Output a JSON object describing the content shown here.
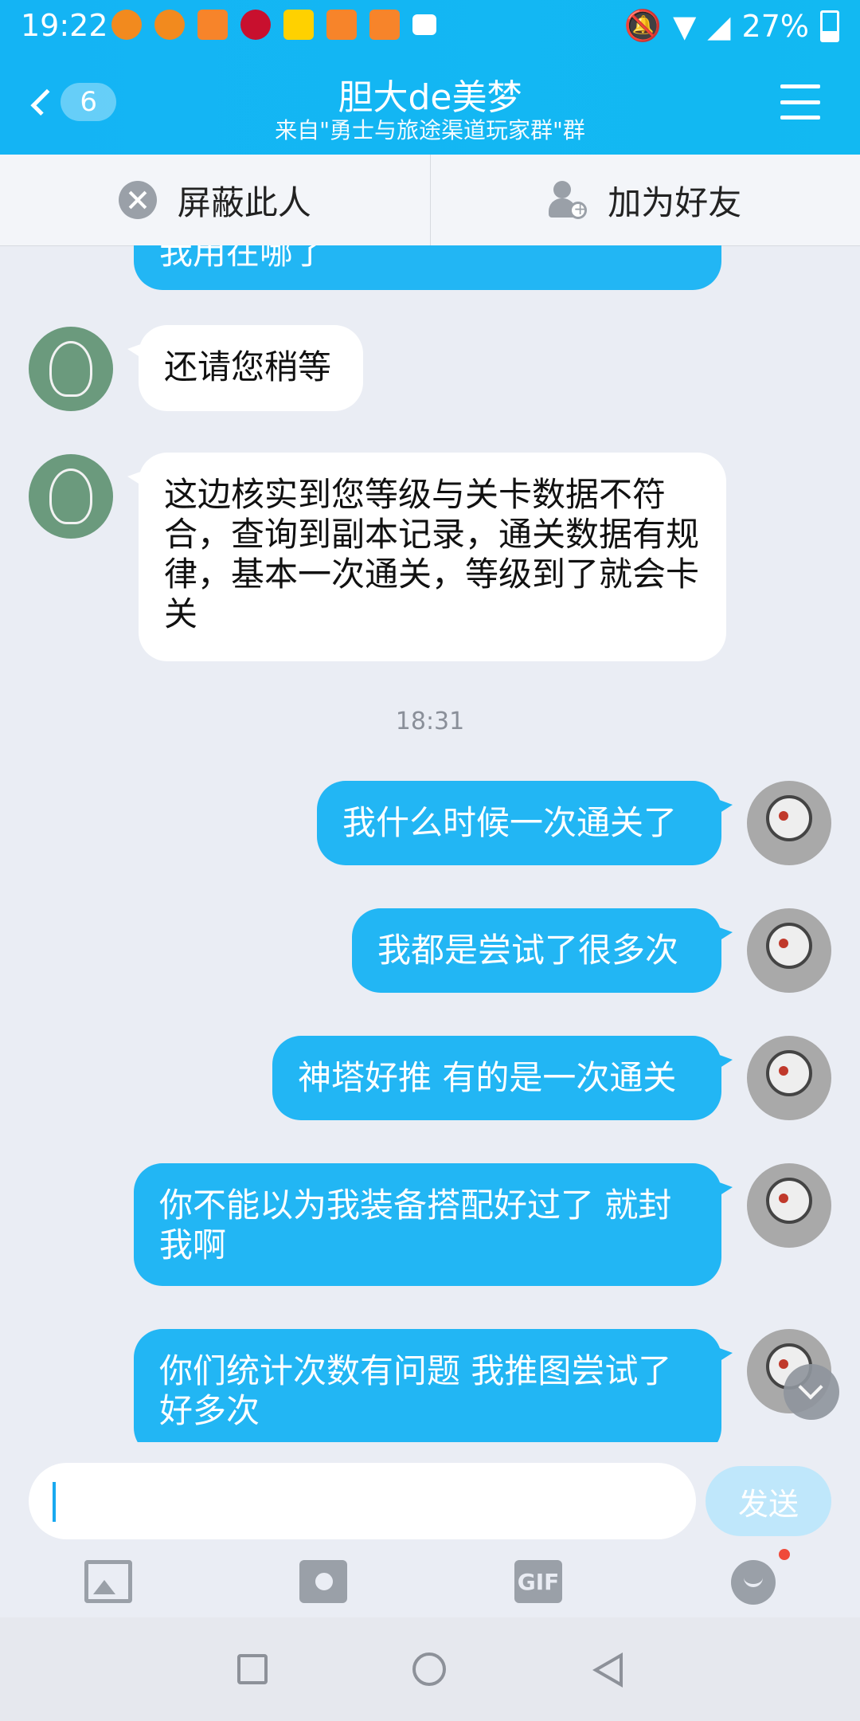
{
  "status_bar": {
    "time": "19:22",
    "battery": "27%",
    "notification_icons": [
      {
        "name": "app-icon-1",
        "color": "#f28a1e"
      },
      {
        "name": "app-icon-2",
        "color": "#f28a1e"
      },
      {
        "name": "app-icon-3",
        "color": "#f7842a"
      },
      {
        "name": "citic-icon",
        "color": "#c8102e"
      },
      {
        "name": "meituan-icon",
        "color": "#ffd100"
      },
      {
        "name": "app-icon-6",
        "color": "#f7842a"
      },
      {
        "name": "app-icon-7",
        "color": "#f7842a"
      },
      {
        "name": "image-icon",
        "color": "#ffffff"
      }
    ]
  },
  "header": {
    "back_count": "6",
    "title": "胆大de美梦",
    "subtitle": "来自\"勇士与旅途渠道玩家群\"群"
  },
  "actions": {
    "block": "屏蔽此人",
    "add_friend": "加为好友"
  },
  "messages": {
    "partial_top": "我用在哪了",
    "m1": "还请您稍等",
    "m2": "这边核实到您等级与关卡数据不符合，查询到副本记录，通关数据有规律，基本一次通关，等级到了就会卡关",
    "time": "18:31",
    "m3": "我什么时候一次通关了",
    "m4": "我都是尝试了很多次",
    "m5": "神塔好推 有的是一次通关",
    "m6": "你不能以为我装备搭配好过了 就封我啊",
    "m7": "你们统计次数有问题 我推图尝试了 好多次"
  },
  "input": {
    "send": "发送",
    "gif": "GIF"
  },
  "colors": {
    "accent": "#14b4f4",
    "outgoing_bubble": "#22b6f4",
    "incoming_bubble": "#ffffff",
    "background": "#eaedf4"
  }
}
